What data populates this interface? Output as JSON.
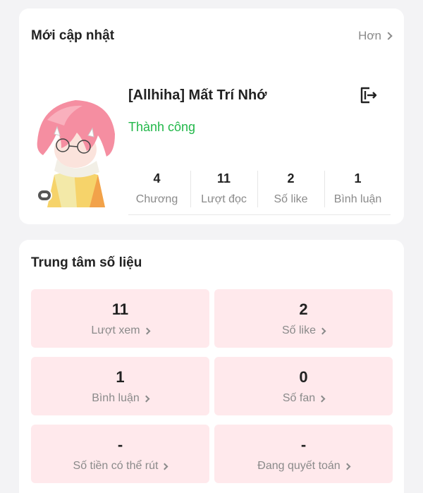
{
  "recent": {
    "title": "Mới cập nhật",
    "more_label": "Hơn",
    "book": {
      "title": "[Allhiha] Mất Trí Nhớ",
      "status": "Thành công",
      "status_color": "#22b84a",
      "stats": [
        {
          "value": "4",
          "label": "Chương"
        },
        {
          "value": "11",
          "label": "Lượt đọc"
        },
        {
          "value": "2",
          "label": "Số like"
        },
        {
          "value": "1",
          "label": "Bình luận"
        }
      ]
    }
  },
  "data_center": {
    "title": "Trung tâm số liệu",
    "tile_color": "#ffe9ec",
    "tiles": [
      {
        "value": "11",
        "label": "Lượt xem"
      },
      {
        "value": "2",
        "label": "Số like"
      },
      {
        "value": "1",
        "label": "Bình luận"
      },
      {
        "value": "0",
        "label": "Số fan"
      },
      {
        "value": "-",
        "label": "Số tiền có thể rút"
      },
      {
        "value": "-",
        "label": "Đang quyết toán"
      }
    ]
  }
}
